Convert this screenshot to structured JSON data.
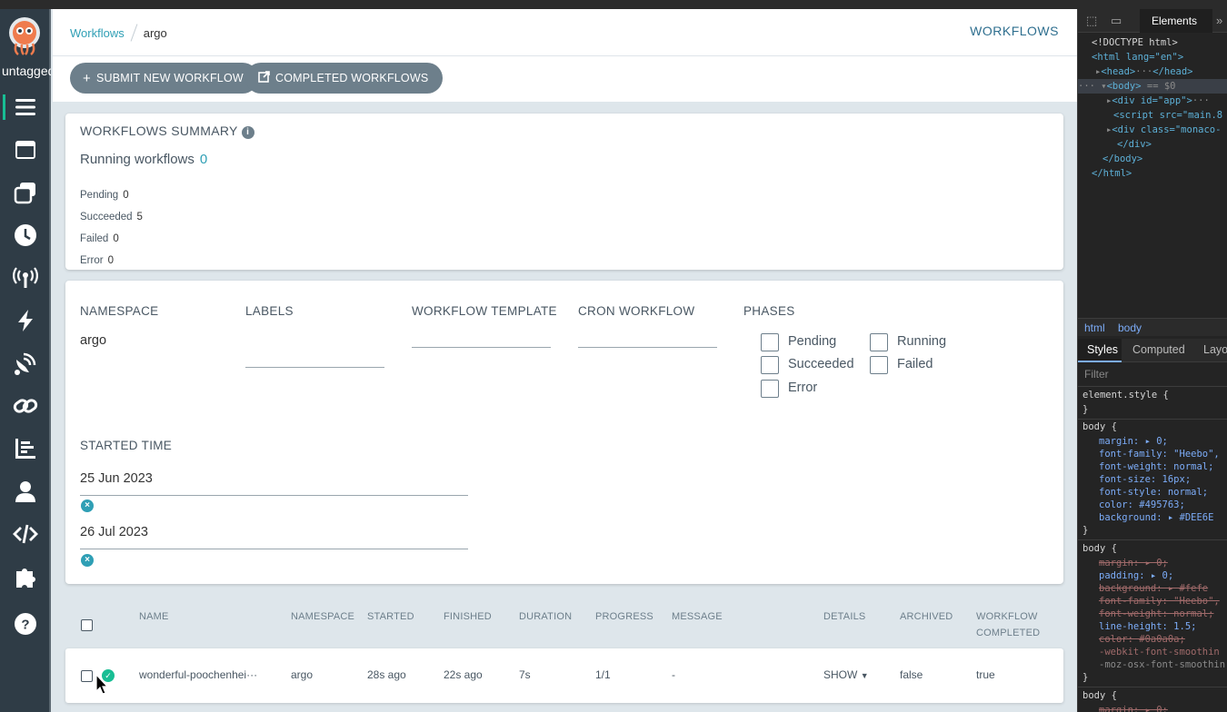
{
  "nav": {
    "version": "untagged",
    "items": [
      {
        "name": "workflows",
        "active": true
      },
      {
        "name": "workflow-templates"
      },
      {
        "name": "cluster-workflow-templates"
      },
      {
        "name": "cron-workflows"
      },
      {
        "name": "event-sources"
      },
      {
        "name": "sensors"
      },
      {
        "name": "event-flow"
      },
      {
        "name": "workflow-event-bindings"
      },
      {
        "name": "reports"
      },
      {
        "name": "user-info"
      },
      {
        "name": "api-docs"
      },
      {
        "name": "plugins"
      },
      {
        "name": "help"
      }
    ]
  },
  "breadcrumb": {
    "root": "Workflows",
    "current": "argo"
  },
  "page_title": "WORKFLOWS",
  "actions": {
    "submit": "SUBMIT NEW WORKFLOW",
    "completed": "COMPLETED WORKFLOWS"
  },
  "summary": {
    "title": "WORKFLOWS SUMMARY",
    "running_label": "Running workflows",
    "running_value": "0",
    "pending_label": "Pending",
    "pending_value": "0",
    "succeeded_label": "Succeeded",
    "succeeded_value": "5",
    "failed_label": "Failed",
    "failed_value": "0",
    "error_label": "Error",
    "error_value": "0"
  },
  "filters": {
    "namespace_label": "NAMESPACE",
    "namespace_value": "argo",
    "labels_label": "LABELS",
    "template_label": "WORKFLOW TEMPLATE",
    "cron_label": "CRON WORKFLOW",
    "phases_label": "PHASES",
    "phases": [
      "Pending",
      "Running",
      "Succeeded",
      "Failed",
      "Error"
    ],
    "started_label": "STARTED TIME",
    "started_from": "25 Jun 2023",
    "started_to": "26 Jul 2023"
  },
  "table": {
    "columns": [
      "NAME",
      "NAMESPACE",
      "STARTED",
      "FINISHED",
      "DURATION",
      "PROGRESS",
      "MESSAGE",
      "DETAILS",
      "ARCHIVED",
      "WORKFLOW",
      "COMPLETED"
    ],
    "rows": [
      {
        "name": "wonderful-poochenhei···",
        "namespace": "argo",
        "started": "28s ago",
        "finished": "22s ago",
        "duration": "7s",
        "progress": "1/1",
        "message": "-",
        "details": "SHOW",
        "archived": "false",
        "completed": "true",
        "status": "succeeded"
      }
    ]
  },
  "devtools": {
    "tab_elements": "Elements",
    "lines": {
      "doctype": "<!DOCTYPE html>",
      "html_open": "<html lang=\"en\">",
      "head": "<head>",
      "head_close": "</head>",
      "body": "<body>",
      "body_eq": "== $0",
      "div_app": "<div id=\"app\">",
      "script": "<script src=\"main.8",
      "div_monaco": "<div class=\"monaco-",
      "div_close": "</div>",
      "body_close": "</body>",
      "html_close": "</html>"
    },
    "breadcrumb_html": "html",
    "breadcrumb_body": "body",
    "style_tabs": [
      "Styles",
      "Computed",
      "Layo"
    ],
    "filter_placeholder": "Filter",
    "rules": {
      "element_style": "element.style {",
      "close": "}",
      "body1": "body {",
      "margin": "margin: ▸ 0;",
      "font_family": "font-family: \"Heebo\",",
      "font_weight": "font-weight: normal;",
      "font_size": "font-size: 16px;",
      "font_style": "font-style: normal;",
      "color": "color: #495763;",
      "background": "background: ▸ #DEE6E",
      "body2": "body {",
      "margin2": "margin: ▸ 0;",
      "padding": "padding: ▸ 0;",
      "background2": "background: ▸ #fefe",
      "font_family2": "font-family: \"Heebo\",",
      "font_weight2": "font-weight: normal;",
      "line_height": "line-height: 1.5;",
      "color2": "color: #0a0a0a;",
      "webkit": "-webkit-font-smoothin",
      "moz": "-moz-osx-font-smoothin",
      "body3": "body {",
      "margin3": "margin: ▸ 0;"
    }
  }
}
